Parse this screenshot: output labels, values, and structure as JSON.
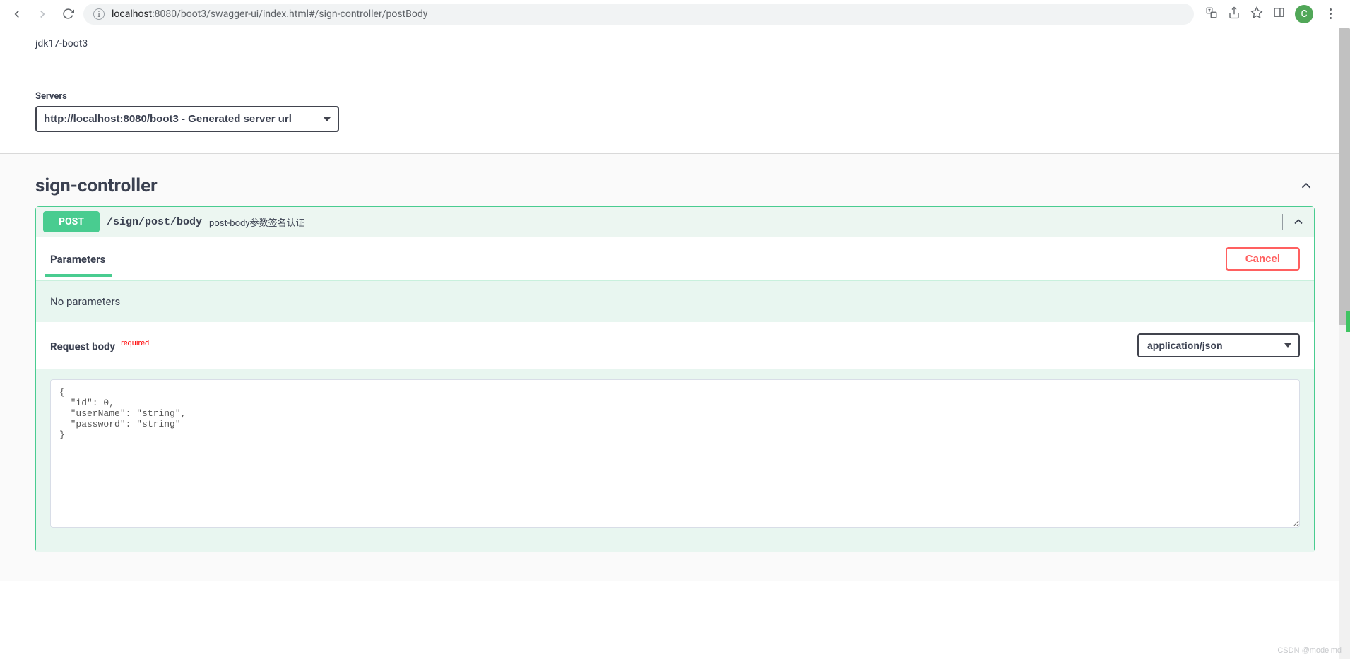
{
  "browser": {
    "url_host": "localhost",
    "url_port_path": ":8080/boot3/swagger-ui/index.html#/sign-controller/postBody",
    "profile_letter": "C"
  },
  "header": {
    "description": "jdk17-boot3"
  },
  "servers": {
    "label": "Servers",
    "selected": "http://localhost:8080/boot3 - Generated server url"
  },
  "tag": {
    "name": "sign-controller"
  },
  "operation": {
    "method": "POST",
    "path": "/sign/post/body",
    "summary": "post-body参数签名认证",
    "parameters_label": "Parameters",
    "cancel_label": "Cancel",
    "no_params_text": "No parameters",
    "request_body_label": "Request body",
    "required_label": "required",
    "content_type": "application/json",
    "body_example": "{\n  \"id\": 0,\n  \"userName\": \"string\",\n  \"password\": \"string\"\n}"
  },
  "watermark": "CSDN @modelmd"
}
